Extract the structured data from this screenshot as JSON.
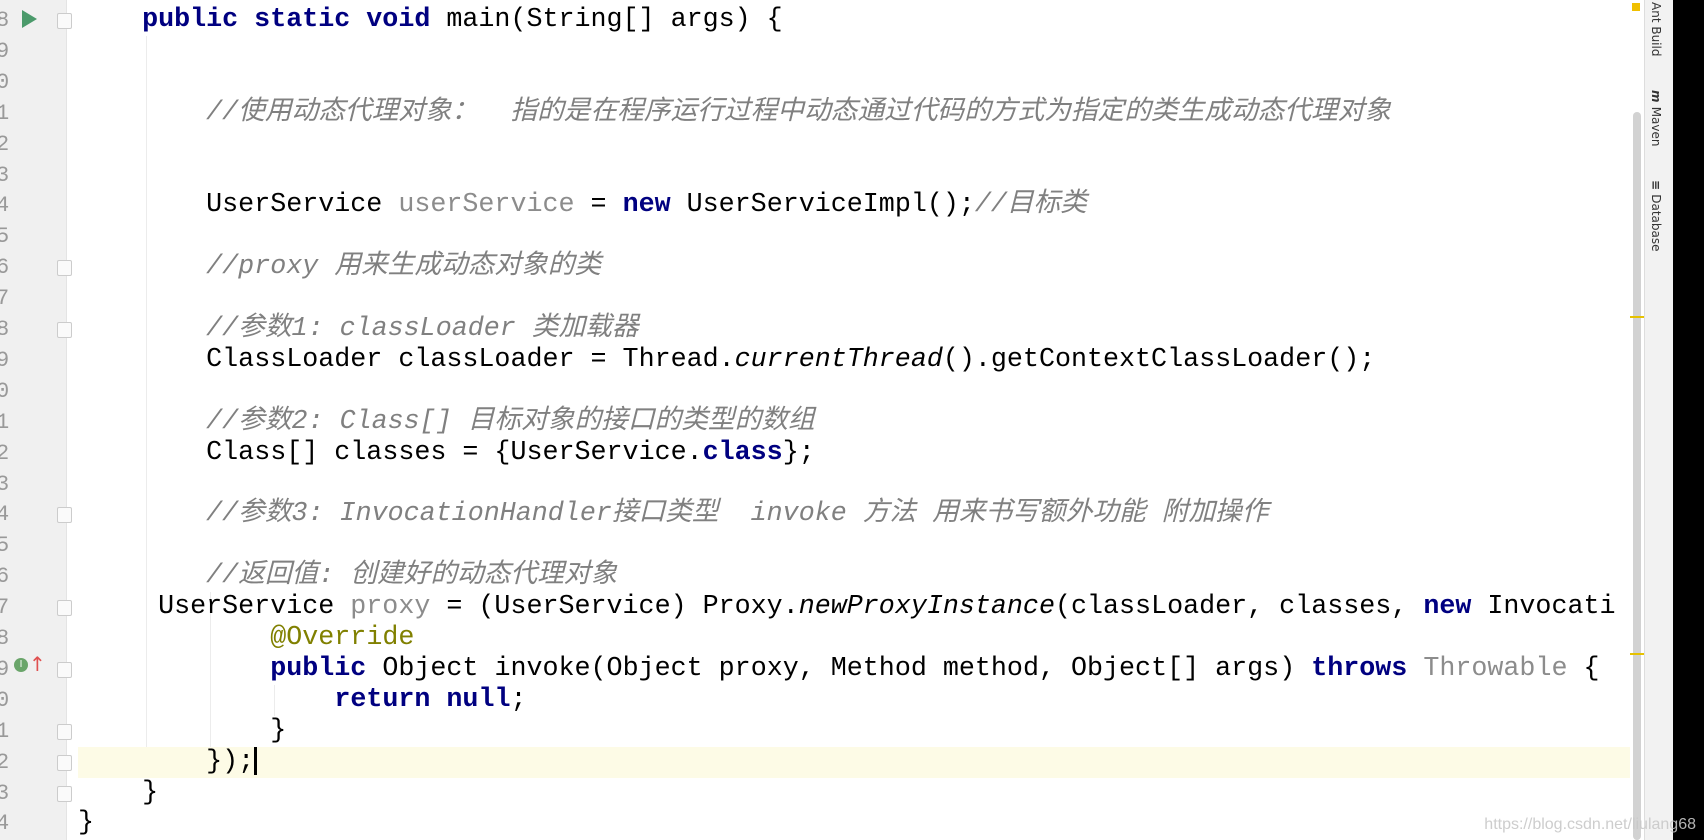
{
  "gutter": {
    "line_numbers": [
      "8",
      "9",
      "0",
      "1",
      "2",
      "3",
      "4",
      "5",
      "6",
      "7",
      "8",
      "9",
      "0",
      "1",
      "2",
      "3",
      "4",
      "5",
      "6",
      "7",
      "8",
      "9",
      "0",
      "1",
      "2",
      "3",
      "4"
    ]
  },
  "code": {
    "current_line": 24,
    "lines": [
      {
        "indent": 4,
        "tokens": [
          [
            "public static void",
            "kw"
          ],
          [
            " main(String[] args) {",
            ""
          ]
        ]
      },
      {
        "indent": 0,
        "tokens": []
      },
      {
        "indent": 0,
        "tokens": []
      },
      {
        "indent": 8,
        "tokens": [
          [
            "//使用动态代理对象：  指的是在程序运行过程中动态通过代码的方式为指定的类生成动态代理对象",
            "cm"
          ]
        ]
      },
      {
        "indent": 0,
        "tokens": []
      },
      {
        "indent": 0,
        "tokens": []
      },
      {
        "indent": 8,
        "tokens": [
          [
            "UserService ",
            ""
          ],
          [
            "userService",
            "gv"
          ],
          [
            " = ",
            ""
          ],
          [
            "new",
            "kw"
          ],
          [
            " UserServiceImpl();",
            ""
          ],
          [
            "//目标类",
            "cm"
          ]
        ]
      },
      {
        "indent": 0,
        "tokens": []
      },
      {
        "indent": 8,
        "tokens": [
          [
            "//proxy 用来生成动态对象的类",
            "cm"
          ]
        ]
      },
      {
        "indent": 0,
        "tokens": []
      },
      {
        "indent": 8,
        "tokens": [
          [
            "//参数1: classLoader 类加载器",
            "cm"
          ]
        ]
      },
      {
        "indent": 8,
        "tokens": [
          [
            "ClassLoader classLoader = Thread.",
            ""
          ],
          [
            "currentThread",
            "it"
          ],
          [
            "().getContextClassLoader();",
            ""
          ]
        ]
      },
      {
        "indent": 0,
        "tokens": []
      },
      {
        "indent": 8,
        "tokens": [
          [
            "//参数2: Class[] 目标对象的接口的类型的数组",
            "cm"
          ]
        ]
      },
      {
        "indent": 8,
        "tokens": [
          [
            "Class[] classes = {UserService.",
            ""
          ],
          [
            "class",
            "kw"
          ],
          [
            "};",
            ""
          ]
        ]
      },
      {
        "indent": 0,
        "tokens": []
      },
      {
        "indent": 8,
        "tokens": [
          [
            "//参数3: InvocationHandler接口类型  invoke 方法 用来书写额外功能 附加操作",
            "cm"
          ]
        ]
      },
      {
        "indent": 0,
        "tokens": []
      },
      {
        "indent": 8,
        "tokens": [
          [
            "//返回值: 创建好的动态代理对象",
            "cm"
          ]
        ]
      },
      {
        "indent": 5,
        "tokens": [
          [
            "UserService ",
            ""
          ],
          [
            "proxy",
            "gv"
          ],
          [
            " = (UserService) Proxy.",
            ""
          ],
          [
            "newProxyInstance",
            "it"
          ],
          [
            "(classLoader, classes, ",
            ""
          ],
          [
            "new",
            "kw"
          ],
          [
            " Invocati",
            ""
          ]
        ]
      },
      {
        "indent": 12,
        "tokens": [
          [
            "@Override",
            "an"
          ]
        ]
      },
      {
        "indent": 12,
        "tokens": [
          [
            "public",
            "kw"
          ],
          [
            " Object invoke(Object proxy, Method method, Object[] args) ",
            ""
          ],
          [
            "throws",
            "kw"
          ],
          [
            " ",
            ""
          ],
          [
            "Throwable",
            "gv"
          ],
          [
            " {",
            ""
          ]
        ]
      },
      {
        "indent": 16,
        "tokens": [
          [
            "return null",
            "kw"
          ],
          [
            ";",
            ""
          ]
        ]
      },
      {
        "indent": 12,
        "tokens": [
          [
            "}",
            ""
          ]
        ]
      },
      {
        "indent": 8,
        "tokens": [
          [
            "});",
            ""
          ]
        ]
      },
      {
        "indent": 4,
        "tokens": [
          [
            "}",
            ""
          ]
        ]
      },
      {
        "indent": 0,
        "tokens": [
          [
            "}",
            ""
          ]
        ]
      }
    ]
  },
  "tool_windows": [
    {
      "label": "Ant Build",
      "icon": "ant-icon"
    },
    {
      "label": "Maven",
      "icon": "maven-icon"
    },
    {
      "label": "Database",
      "icon": "database-icon"
    }
  ],
  "watermark": "https://blog.csdn.net/liulang68",
  "colors": {
    "keyword": "#000080",
    "comment": "#808080",
    "annotation": "#808000",
    "current_line": "#fdfbe6"
  }
}
